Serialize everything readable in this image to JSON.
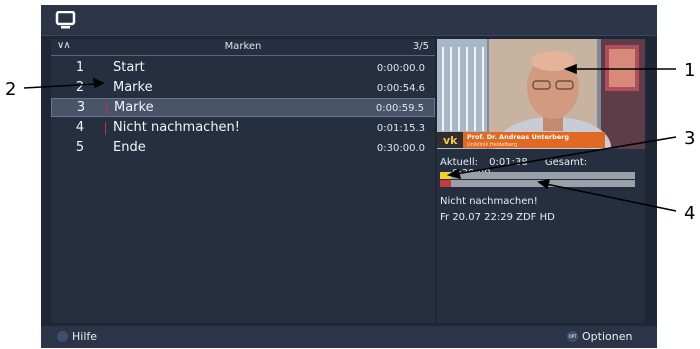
{
  "header": {
    "list_title": "Marken",
    "count": "3/5"
  },
  "marks": [
    {
      "num": "1",
      "name": "Start",
      "time": "0:00:00.0",
      "flag": false
    },
    {
      "num": "2",
      "name": "Marke",
      "time": "0:00:54.6",
      "flag": false
    },
    {
      "num": "3",
      "name": "Marke",
      "time": "0:00:59.5",
      "flag": true,
      "selected": true
    },
    {
      "num": "4",
      "name": "Nicht nachmachen!",
      "time": "0:01:15.3",
      "flag": true
    },
    {
      "num": "5",
      "name": "Ende",
      "time": "0:30:00.0",
      "flag": false
    }
  ],
  "preview": {
    "banner_name": "Prof. Dr. Andreas Unterberg",
    "banner_sub": "Uniklinik Heidelberg",
    "channel_logo": "vk"
  },
  "info": {
    "current_label": "Aktuell:",
    "current_value": "0:01:38",
    "total_label": "Gesamt:",
    "total_value": "0:30:00",
    "title": "Nicht nachmachen!",
    "datetime_channel": "Fr 20.07 22:29  ZDF HD",
    "progress_fraction": 0.055
  },
  "footer": {
    "help_label": "Hilfe",
    "options_label": "Optionen",
    "options_badge": "OPT"
  },
  "annotations": [
    "1",
    "2",
    "3",
    "4"
  ]
}
